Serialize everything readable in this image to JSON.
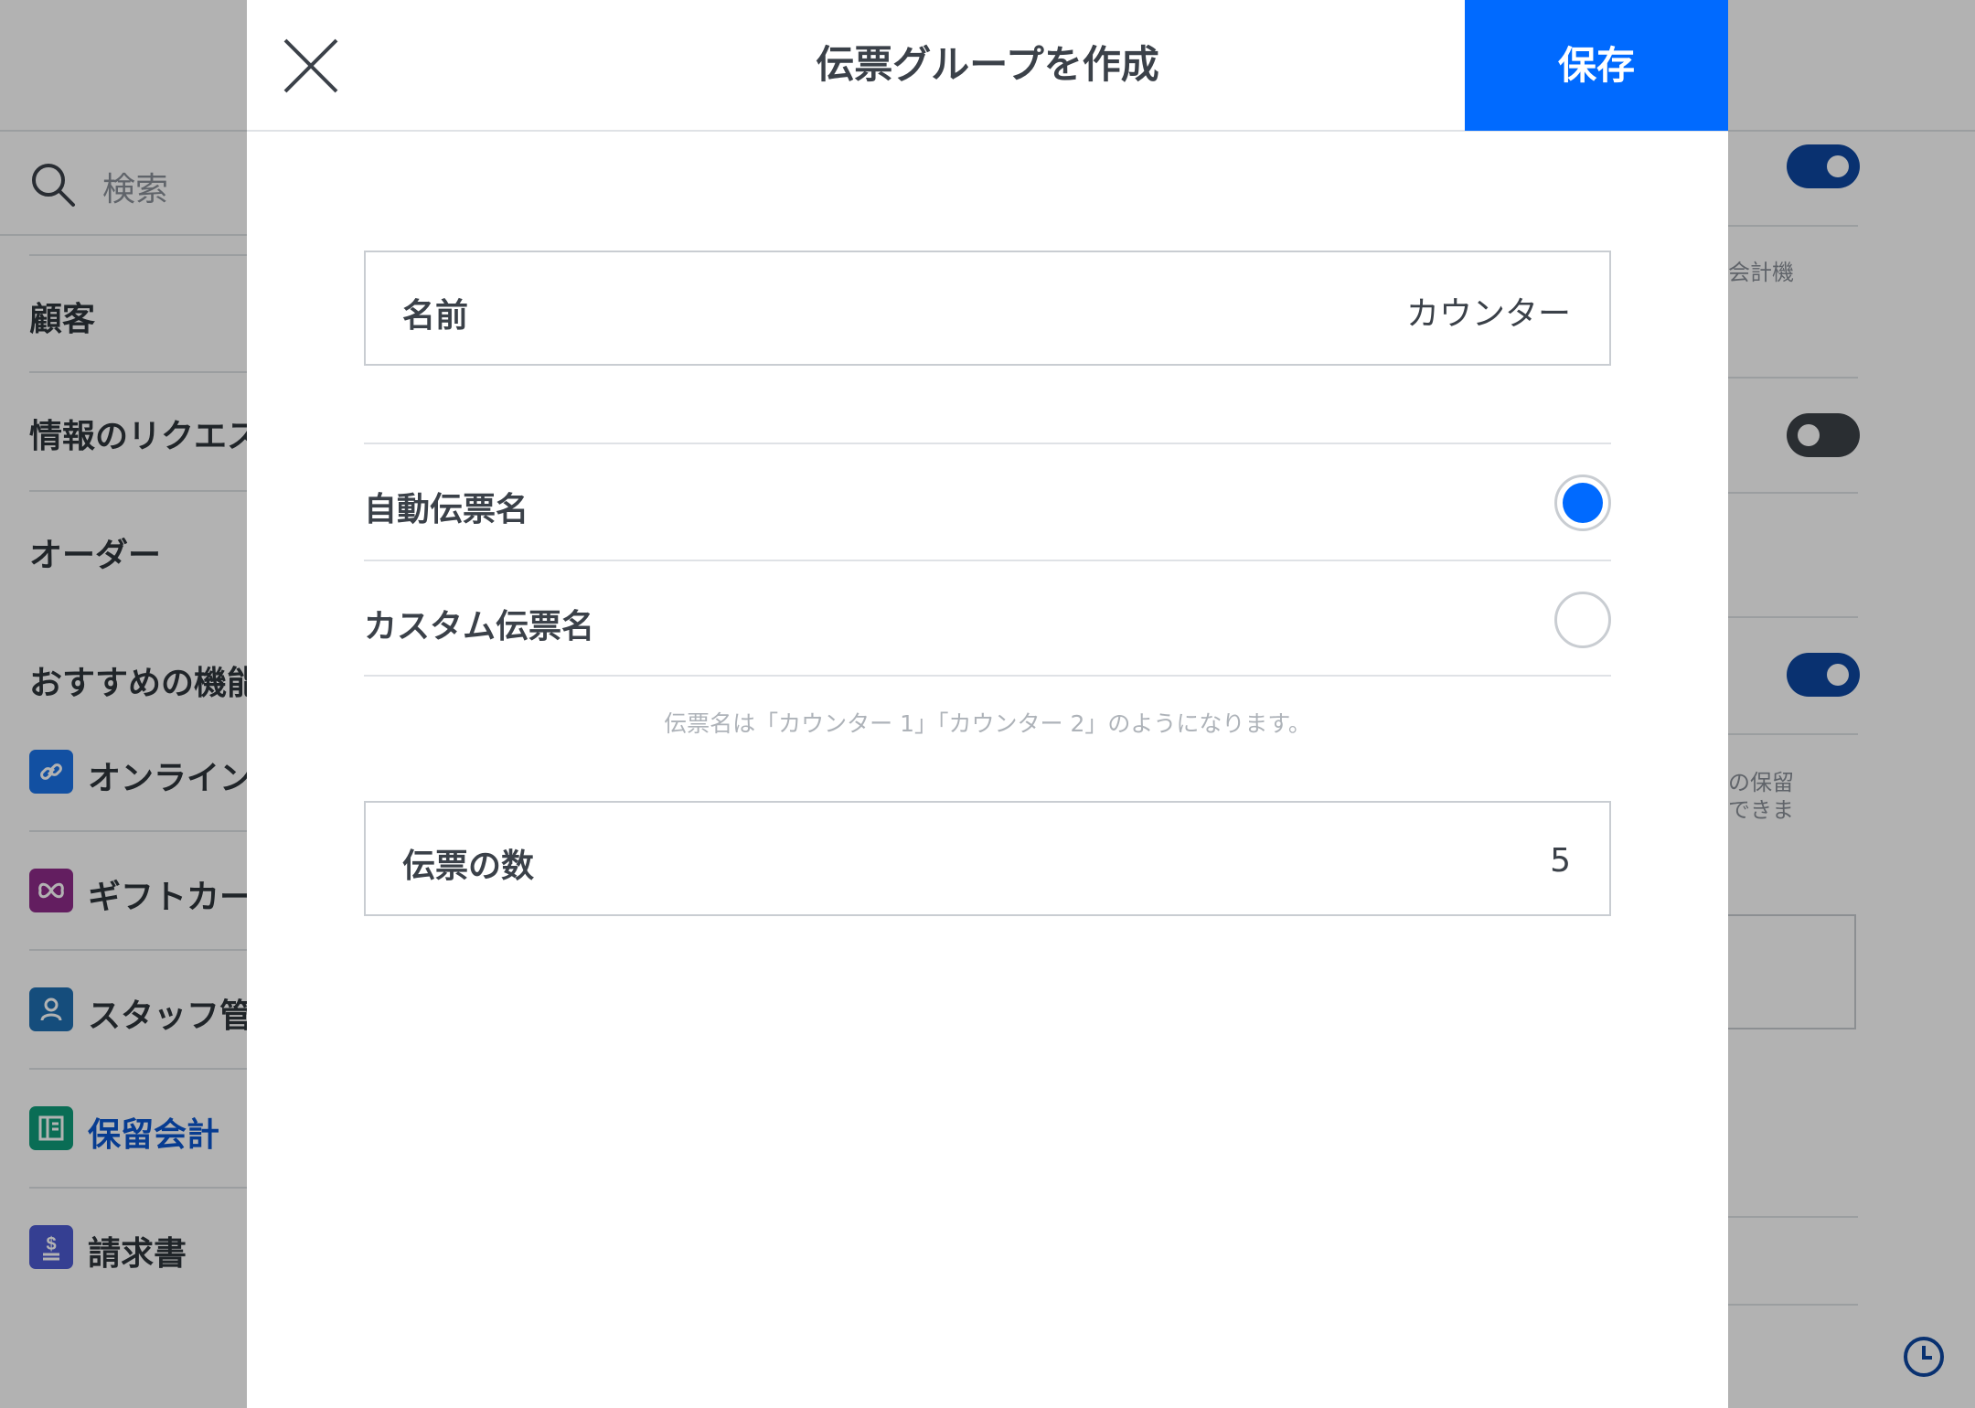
{
  "background": {
    "search_placeholder": "検索",
    "sidebar_items": [
      "顧客",
      "情報のリクエスト",
      "オーダー"
    ],
    "features_heading": "おすすめの機能",
    "features": [
      {
        "label": "オンライン",
        "icon": "link-icon",
        "color": "#1a73e8"
      },
      {
        "label": "ギフトカード",
        "icon": "gift-icon",
        "color": "#8e2c8a"
      },
      {
        "label": "スタッフ管理",
        "icon": "person-icon",
        "color": "#1f6fb2"
      },
      {
        "label": "保留会計",
        "icon": "open-tickets-icon",
        "color": "#0f9d7a",
        "active": true
      },
      {
        "label": "請求書",
        "icon": "invoice-icon",
        "color": "#4d5bd1"
      }
    ],
    "right_texts": [
      "会計機",
      "の保留",
      "できま"
    ],
    "toggles": [
      true,
      false,
      true
    ]
  },
  "modal": {
    "title": "伝票グループを作成",
    "save_label": "保存",
    "name_field": {
      "label": "名前",
      "value": "カウンター"
    },
    "radio_options": [
      {
        "label": "自動伝票名",
        "selected": true
      },
      {
        "label": "カスタム伝票名",
        "selected": false
      }
    ],
    "helper_text": "伝票名は「カウンター 1」「カウンター 2」のようになります。",
    "count_field": {
      "label": "伝票の数",
      "value": "5"
    }
  },
  "colors": {
    "accent": "#006aff",
    "toggle_on": "#0d47a1",
    "toggle_off": "#3d4248"
  }
}
